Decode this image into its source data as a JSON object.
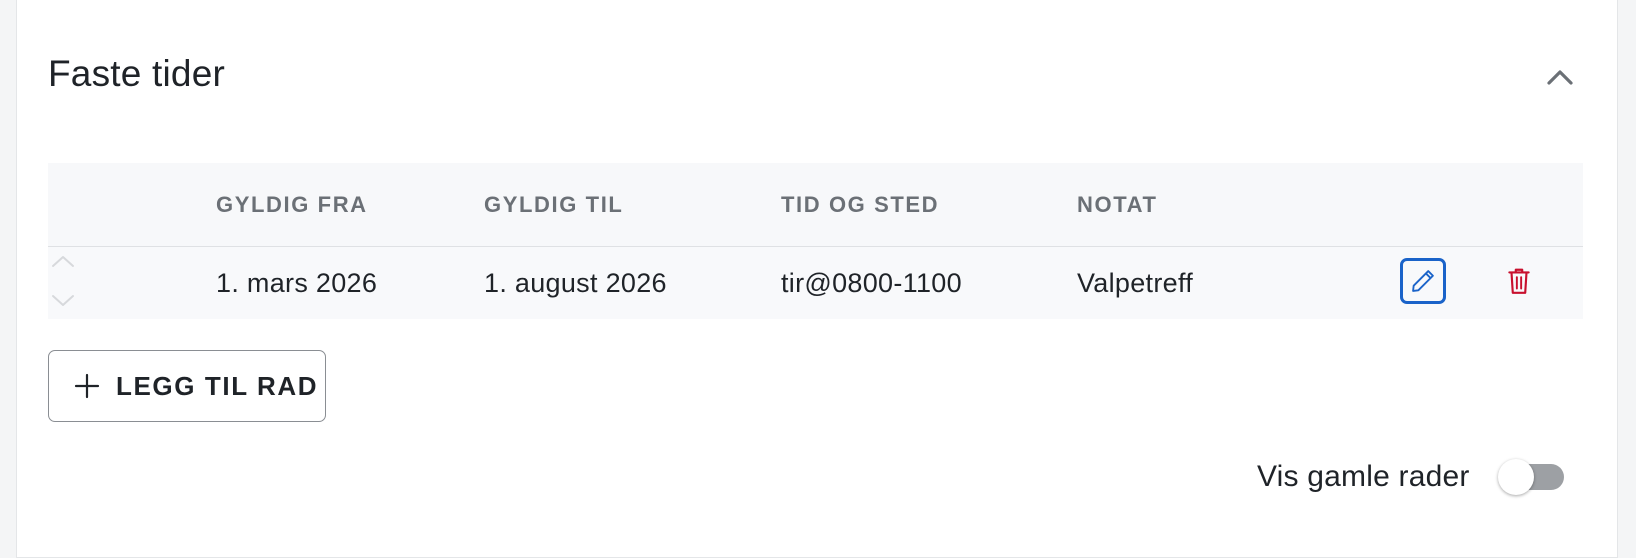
{
  "section": {
    "title": "Faste tider"
  },
  "table": {
    "columns": [
      "GYLDIG FRA",
      "GYLDIG TIL",
      "TID OG STED",
      "NOTAT"
    ],
    "rows": [
      {
        "gyldig_fra": "1. mars 2026",
        "gyldig_til": "1. august 2026",
        "tid_og_sted": "tir@0800-1100",
        "notat": "Valpetreff"
      }
    ]
  },
  "actions": {
    "add_row_label": "LEGG TIL RAD"
  },
  "toggle": {
    "label": "Vis gamle rader",
    "on": false
  },
  "icons": {
    "collapse": "chevron-up-icon",
    "sort_up": "chevron-up-icon",
    "sort_down": "chevron-down-icon",
    "edit": "pencil-icon",
    "delete": "trash-icon",
    "add": "plus-icon"
  },
  "colors": {
    "edit_accent": "#1a63c9",
    "delete_accent": "#c8102e",
    "toggle_track_off": "#9da0a4"
  }
}
